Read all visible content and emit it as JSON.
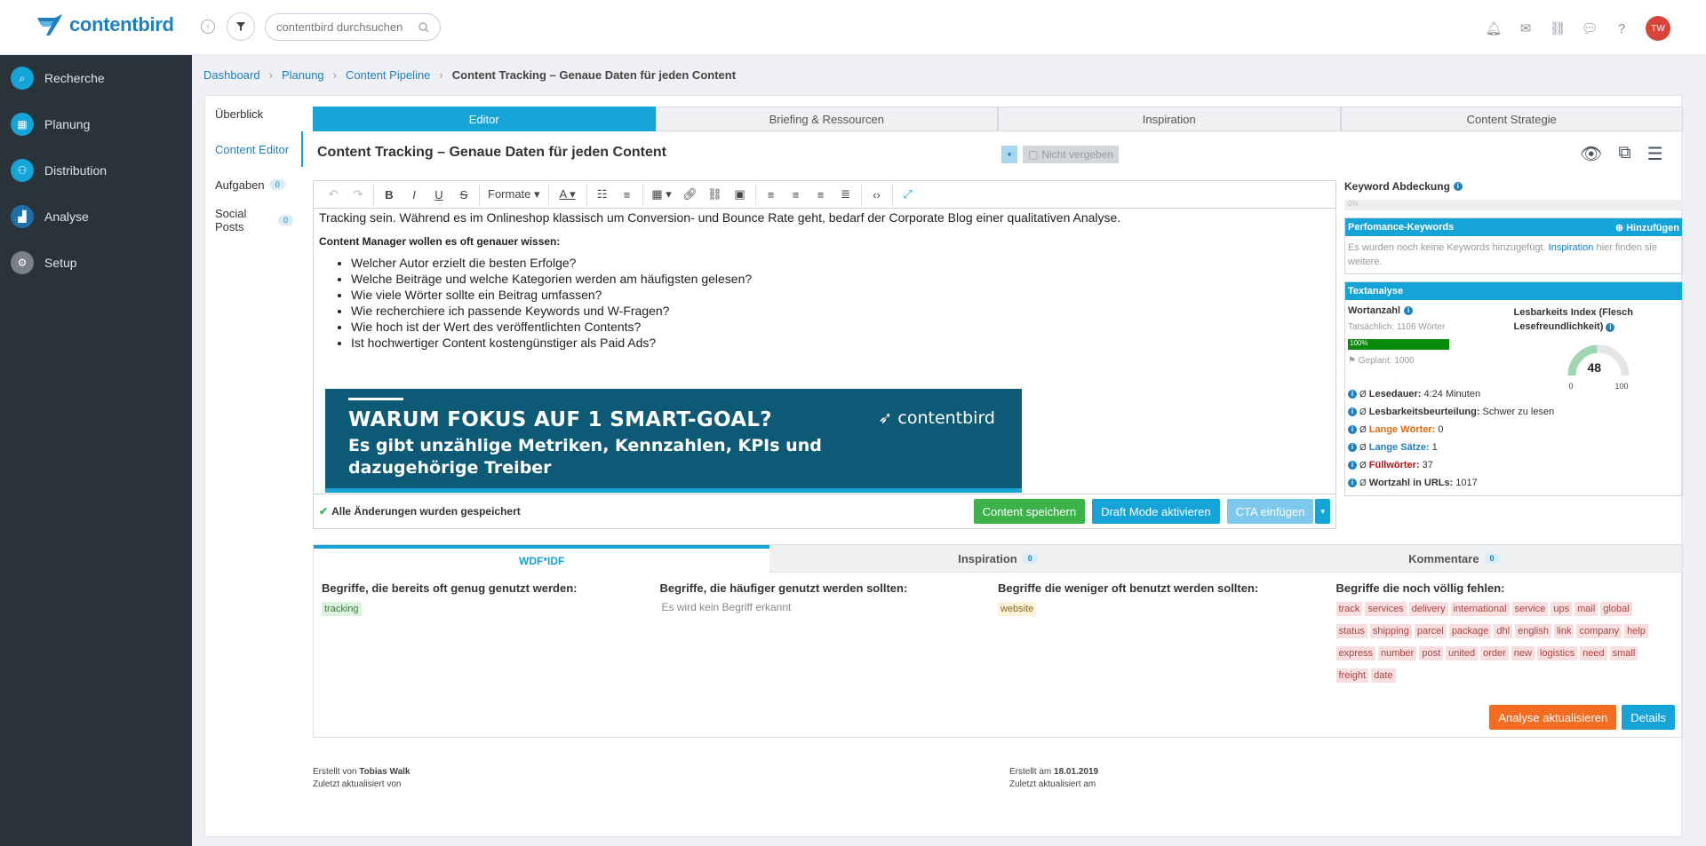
{
  "topbar": {
    "logo_text": "contentbird",
    "search_placeholder": "contentbird durchsuchen",
    "avatar_initials": "TW"
  },
  "sidebar": {
    "items": [
      {
        "label": "Recherche",
        "icon": "search-icon",
        "color": "#14a4d8"
      },
      {
        "label": "Planung",
        "icon": "calendar-icon",
        "color": "#14a4d8"
      },
      {
        "label": "Distribution",
        "icon": "users-icon",
        "color": "#14a4d8"
      },
      {
        "label": "Analyse",
        "icon": "chart-icon",
        "color": "#1e6fa8"
      },
      {
        "label": "Setup",
        "icon": "gear-icon",
        "color": "#7a8089"
      }
    ]
  },
  "breadcrumb": {
    "items": [
      "Dashboard",
      "Planung",
      "Content Pipeline"
    ],
    "current": "Content Tracking – Genaue Daten für jeden Content"
  },
  "leftnav": {
    "items": [
      {
        "label": "Überblick"
      },
      {
        "label": "Content Editor"
      },
      {
        "label": "Aufgaben",
        "count": "0"
      },
      {
        "label": "Social Posts",
        "count": "0"
      }
    ]
  },
  "tabs": [
    "Editor",
    "Briefing & Ressourcen",
    "Inspiration",
    "Content Strategie"
  ],
  "document": {
    "title": "Content Tracking – Genaue Daten für jeden Content",
    "assignee": "Nicht vergeben"
  },
  "toolbar": {
    "format_label": "Formate"
  },
  "editor": {
    "intro": "Tracking sein. Während es im Onlineshop klassisch um Conversion- und Bounce Rate geht, bedarf der Corporate Blog einer qualitativen Analyse.",
    "heading": "Content Manager wollen es oft genauer wissen:",
    "bullets": [
      "Welcher Autor erzielt die besten Erfolge?",
      "Welche Beiträge und welche Kategorien werden am häufigsten gelesen?",
      "Wie viele Wörter sollte ein Beitrag umfassen?",
      "Wie recherchiere ich passende Keywords und W-Fragen?",
      "Wie hoch ist der Wert des veröffentlichten Contents?",
      "Ist hochwertiger Content kostengünstiger als Paid Ads?"
    ],
    "banner": {
      "title": "WARUM FOKUS AUF 1 SMART-GOAL?",
      "line1": "Es gibt unzählige Metriken, Kennzahlen, KPIs und",
      "line2": "dazugehörige Treiber",
      "logo": "contentbird"
    },
    "saved_status": "Alle Änderungen wurden gespeichert",
    "save_button": "Content speichern",
    "draft_button": "Draft Mode aktivieren",
    "cta_button": "CTA einfügen"
  },
  "right_panel": {
    "keyword_coverage_label": "Keyword Abdeckung",
    "keyword_coverage_value": "0%",
    "perf_title": "Perfomance-Keywords",
    "perf_add": "Hinzufügen",
    "perf_text_1": "Es wurden noch keine Keywords hinzugefügt.",
    "perf_link": "Inspiration",
    "perf_text_2": "hier finden sie weitere.",
    "textanalyse_title": "Textanalyse",
    "wortzahl_label": "Wortanzahl",
    "wortzahl_actual": "Tatsächlich: 1106 Wörter",
    "wortzahl_progress": "100%",
    "wortzahl_planned": "Geplant: 1000",
    "flesch_label": "Lesbarkeits Index (Flesch Lesefreundlichkeit)",
    "flesch_value": "48",
    "flesch_min": "0",
    "flesch_max": "100",
    "stats": [
      {
        "label": "Lesedauer:",
        "value": "4:24 Minuten",
        "color": "#333"
      },
      {
        "label": "Lesbarkeitsbeurteilung:",
        "value": "Schwer zu lesen",
        "color": "#333"
      },
      {
        "label": "Lange Wörter:",
        "value": "0",
        "color": "#e06a10"
      },
      {
        "label": "Lange Sätze:",
        "value": "1",
        "color": "#1e7fc1"
      },
      {
        "label": "Füllwörter:",
        "value": "37",
        "color": "#b8141a"
      },
      {
        "label": "Wortzahl in URLs:",
        "value": "1017",
        "color": "#333"
      }
    ]
  },
  "wdf": {
    "tabs": [
      {
        "label": "WDF*IDF"
      },
      {
        "label": "Inspiration",
        "count": "0"
      },
      {
        "label": "Kommentare",
        "count": "0"
      }
    ],
    "col1_title": "Begriffe, die bereits oft genug genutzt werden:",
    "col1_tags": [
      "tracking"
    ],
    "col2_title": "Begriffe, die häufiger genutzt werden sollten:",
    "col2_none": "Es wird kein Begriff erkannt",
    "col3_title": "Begriffe die weniger oft benutzt werden sollten:",
    "col3_tags": [
      "website"
    ],
    "col4_title": "Begriffe die noch völlig fehlen:",
    "col4_tags": [
      "track",
      "services",
      "delivery",
      "international",
      "service",
      "ups",
      "mail",
      "global",
      "status",
      "shipping",
      "parcel",
      "package",
      "dhl",
      "english",
      "link",
      "company",
      "help",
      "express",
      "number",
      "post",
      "united",
      "order",
      "new",
      "logistics",
      "need",
      "small",
      "freight",
      "date"
    ],
    "update_button": "Analyse aktualisieren",
    "details_button": "Details"
  },
  "meta": {
    "created_by_label": "Erstellt von",
    "created_by": "Tobias Walk",
    "updated_by_label": "Zuletzt aktualisiert von",
    "created_at_label": "Erstellt am",
    "created_at": "18.01.2019",
    "updated_at_label": "Zuletzt aktualisiert am"
  },
  "colors": {
    "accent": "#14a4d8",
    "sidebar": "#2a323b",
    "save_green": "#3cb34a",
    "update_orange": "#f26c22"
  }
}
